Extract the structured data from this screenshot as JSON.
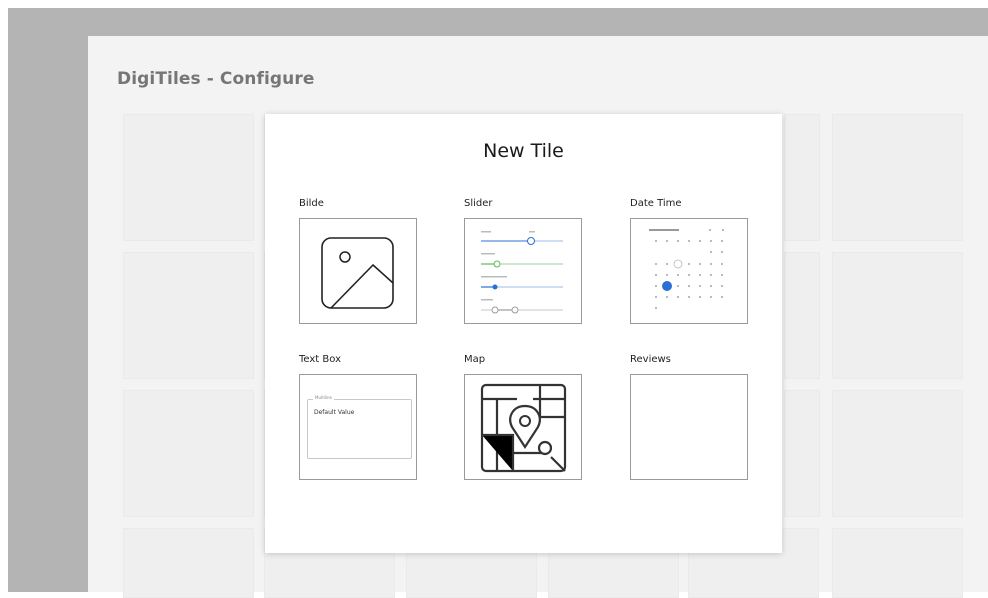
{
  "app": {
    "title": "DigiTiles - Configure"
  },
  "modal": {
    "title": "New Tile",
    "options": [
      {
        "label": "Bilde",
        "icon": "image-icon"
      },
      {
        "label": "Slider",
        "icon": "slider-preview"
      },
      {
        "label": "Date Time",
        "icon": "calendar-preview"
      },
      {
        "label": "Text Box",
        "icon": "textbox-preview",
        "preview": {
          "hint": "Multiline",
          "value": "Default Value"
        }
      },
      {
        "label": "Map",
        "icon": "map-icon"
      },
      {
        "label": "Reviews",
        "icon": ""
      }
    ]
  },
  "colors": {
    "accent": "#2b6fd6",
    "slider_green": "#5cb85c",
    "frame": "#b4b4b4",
    "app_bg": "#f3f3f3"
  }
}
